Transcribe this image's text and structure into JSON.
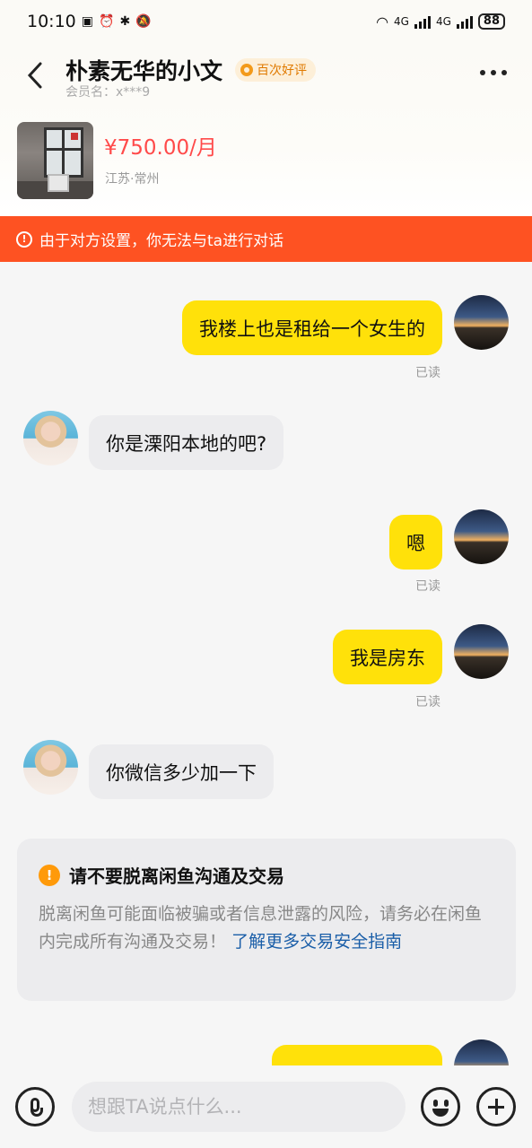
{
  "status_bar": {
    "time": "10:10",
    "icons": [
      "nfc-icon",
      "alarm-icon",
      "bluetooth-icon",
      "mute-icon"
    ],
    "network_1": "4G",
    "network_2": "4G",
    "battery": "88"
  },
  "header": {
    "title": "朴素无华的小文",
    "badge": "百次好评",
    "member_label": "会员名：x***9"
  },
  "listing": {
    "price": "¥750.00/月",
    "location": "江苏·常州"
  },
  "warning_bar": {
    "text": "由于对方设置，你无法与ta进行对话"
  },
  "messages": [
    {
      "from": "me",
      "text": "我楼上也是租给一个女生的",
      "read": "已读"
    },
    {
      "from": "them",
      "text": "你是溧阳本地的吧?"
    },
    {
      "from": "me",
      "text": "嗯",
      "read": "已读"
    },
    {
      "from": "me",
      "text": "我是房东",
      "read": "已读"
    },
    {
      "from": "them",
      "text": "你微信多少加一下"
    }
  ],
  "notice": {
    "title": "请不要脱离闲鱼沟通及交易",
    "body": "脱离闲鱼可能面临被骗或者信息泄露的风险，请务必在闲鱼内完成所有沟通及交易！",
    "link": "了解更多交易安全指南"
  },
  "input_bar": {
    "placeholder": "想跟TA说点什么..."
  },
  "colors": {
    "accent_yellow": "#ffe10a",
    "warning_orange": "#fe5222",
    "price_red": "#ff4a4a",
    "link_blue": "#1a5ea8"
  }
}
